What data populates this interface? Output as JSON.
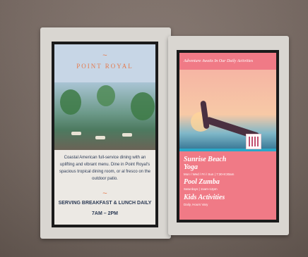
{
  "left_screen": {
    "symbol_top": "~",
    "brand": "POINT ROYAL",
    "description": "Coastal American full-service dining with an uplifting and vibrant menu. Dine in Point Royal's spacious tropical dining room, or al fresco on the outdoor patio.",
    "symbol_mid": "~",
    "hours_title": "SERVING BREAKFAST & LUNCH DAILY",
    "hours": "7AM – 2PM"
  },
  "right_screen": {
    "title": "Adventure Awaits In Our Daily Activities",
    "activities": [
      {
        "name": "Sunrise Beach Yoga",
        "time": "Mon / Wed / Fri / Sun | 7:30-8:30am"
      },
      {
        "name": "Pool Zumba",
        "time": "Saturdays | 11am-12pm"
      },
      {
        "name": "Kids Activities",
        "time": "Daily, Hours Vary"
      }
    ]
  }
}
